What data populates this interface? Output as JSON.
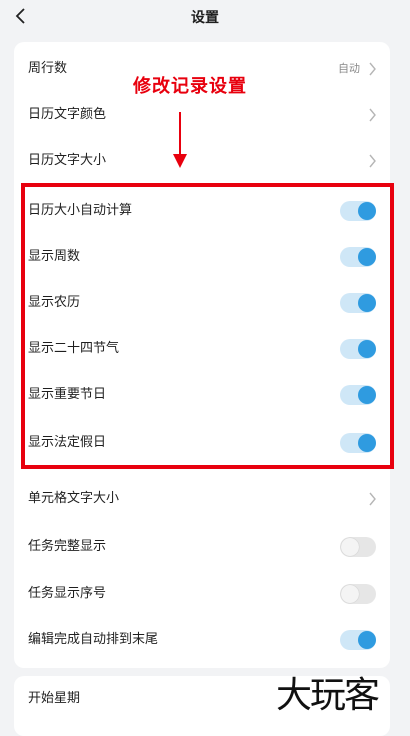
{
  "header": {
    "title": "设置",
    "back_icon": "chevron-left-icon"
  },
  "annotation": {
    "text": "修改记录设置",
    "color": "#e8000e"
  },
  "settings": [
    {
      "label": "周行数",
      "value": "自动",
      "control": "chevron"
    },
    {
      "label": "日历文字颜色",
      "control": "chevron"
    },
    {
      "label": "日历文字大小",
      "control": "chevron"
    },
    {
      "label": "日历大小自动计算",
      "control": "toggle",
      "on": true
    },
    {
      "label": "显示周数",
      "control": "toggle",
      "on": true
    },
    {
      "label": "显示农历",
      "control": "toggle",
      "on": true
    },
    {
      "label": "显示二十四节气",
      "control": "toggle",
      "on": true
    },
    {
      "label": "显示重要节日",
      "control": "toggle",
      "on": true
    },
    {
      "label": "显示法定假日",
      "control": "toggle",
      "on": true
    },
    {
      "label": "单元格文字大小",
      "control": "chevron"
    },
    {
      "label": "任务完整显示",
      "control": "toggle",
      "on": false
    },
    {
      "label": "任务显示序号",
      "control": "toggle",
      "on": false
    },
    {
      "label": "编辑完成自动排到末尾",
      "control": "toggle",
      "on": true
    }
  ],
  "settings2": [
    {
      "label": "开始星期"
    }
  ],
  "watermark": "大玩客",
  "colors": {
    "toggle_on": "#2f9be0",
    "toggle_on_track": "#cfe7f7",
    "highlight": "#e8000e"
  }
}
